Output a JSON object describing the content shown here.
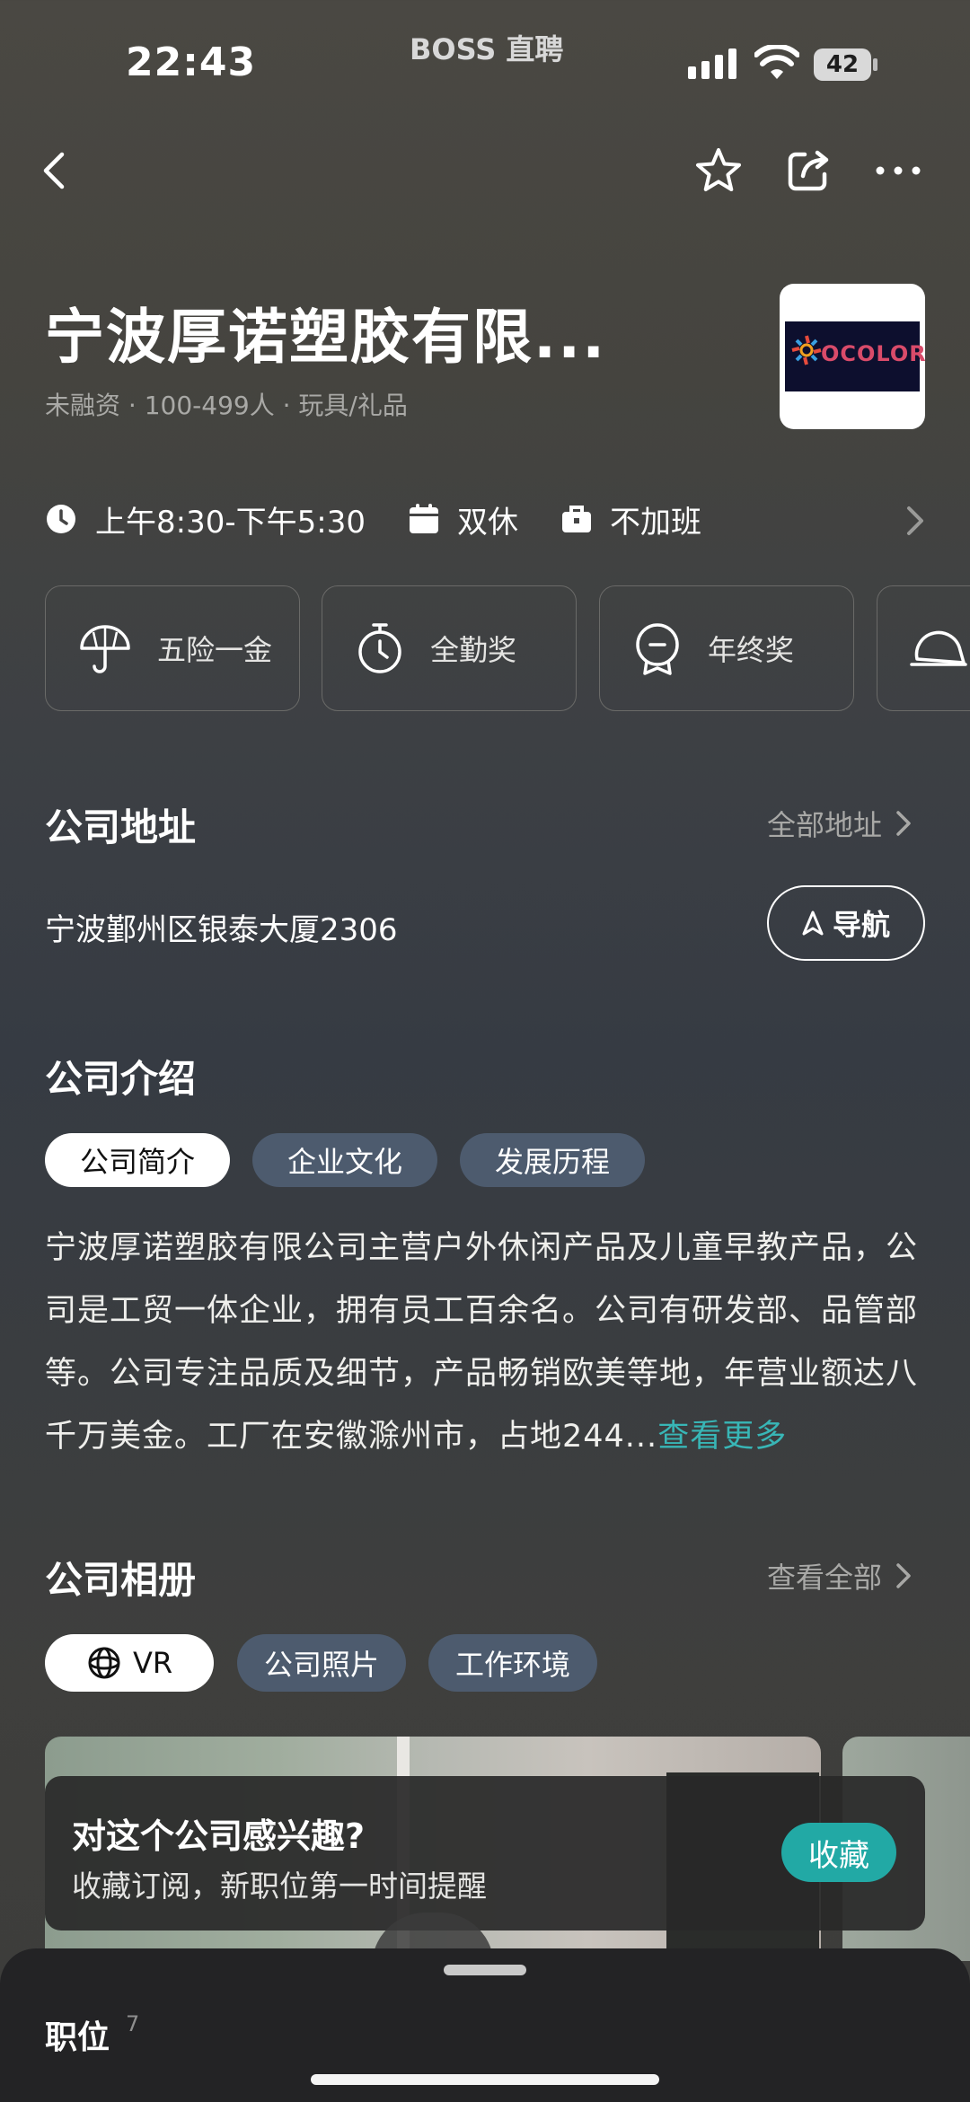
{
  "status_bar": {
    "time": "22:43",
    "app_name": "BOSS 直聘",
    "battery": "42"
  },
  "company": {
    "name": "宁波厚诺塑胶有限...",
    "meta": "未融资 · 100-499人 · 玩具/礼品",
    "logo_text": "OCOLOR"
  },
  "info": {
    "hours": "上午8:30-下午5:30",
    "rest": "双休",
    "overtime": "不加班"
  },
  "benefits": [
    "五险一金",
    "全勤奖",
    "年终奖"
  ],
  "address_section": {
    "title": "公司地址",
    "link": "全部地址",
    "address": "宁波鄞州区银泰大厦2306",
    "nav_label": "导航"
  },
  "intro_section": {
    "title": "公司介绍",
    "tabs": [
      "公司简介",
      "企业文化",
      "发展历程"
    ],
    "text": "宁波厚诺塑胶有限公司主营户外休闲产品及儿童早教产品，公司是工贸一体企业，拥有员工百余名。公司有研发部、品管部等。公司专注品质及细节，产品畅销欧美等地，年营业额达八千万美金。工厂在安徽滁州市，占地244...",
    "more": "查看更多"
  },
  "album_section": {
    "title": "公司相册",
    "link": "查看全部",
    "tabs": [
      "VR",
      "公司照片",
      "工作环境"
    ]
  },
  "promo": {
    "title": "对这个公司感兴趣?",
    "subtitle": "收藏订阅，新职位第一时间提醒",
    "button": "收藏"
  },
  "jobs": {
    "label": "职位",
    "count": "7"
  }
}
